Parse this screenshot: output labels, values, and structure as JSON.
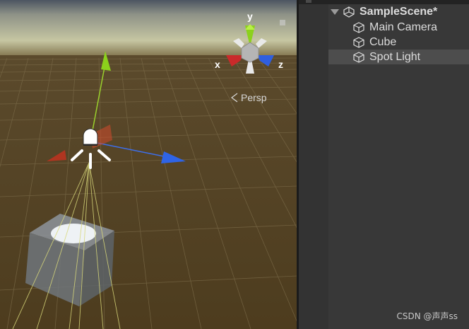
{
  "scene_view": {
    "axis_gizmo": {
      "y_label": "y",
      "x_label": "x",
      "z_label": "z"
    },
    "projection_label": "Persp",
    "colors": {
      "x_axis": "#c63a24",
      "y_axis": "#8cd11c",
      "z_axis": "#2f64e6",
      "ground": "#4f3e20",
      "sky": "#c9c9a6"
    }
  },
  "hierarchy": {
    "scene_name": "SampleScene*",
    "items": [
      {
        "label": "Main Camera",
        "icon": "gameobject-cube-icon",
        "selected": false
      },
      {
        "label": "Cube",
        "icon": "gameobject-cube-icon",
        "selected": false
      },
      {
        "label": "Spot Light",
        "icon": "gameobject-cube-icon",
        "selected": true
      }
    ]
  },
  "watermark": "CSDN @声声ss"
}
